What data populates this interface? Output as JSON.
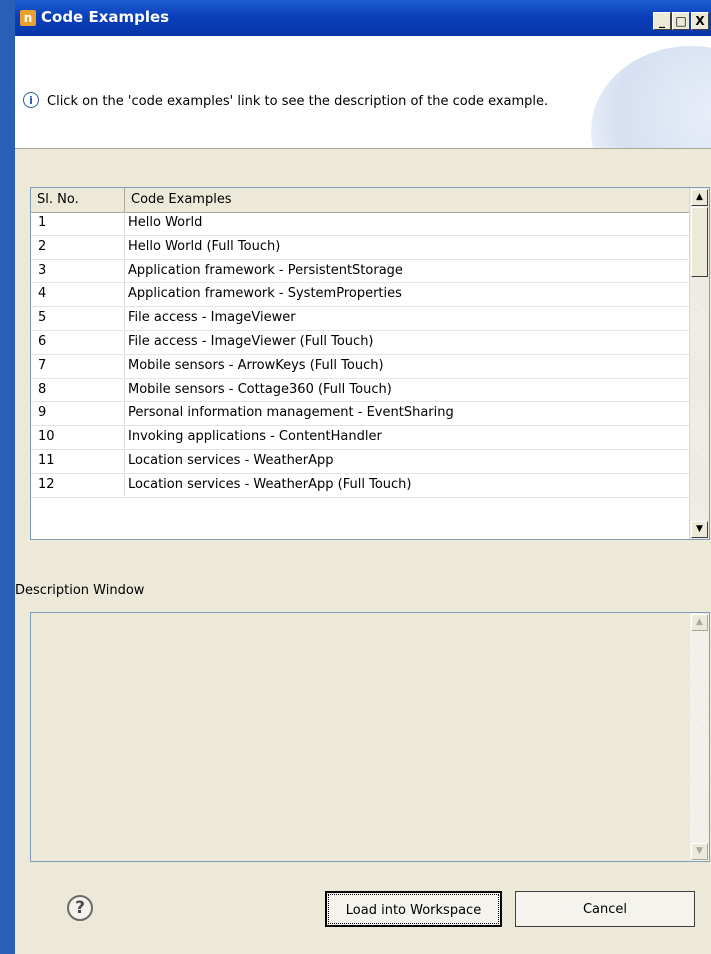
{
  "window": {
    "title": "Code Examples",
    "app_icon_glyph": "n",
    "controls": {
      "minimize": "_",
      "maximize": "□",
      "close": "X"
    }
  },
  "banner": {
    "message": "Click on the 'code examples' link to see the description of the code example.",
    "icon": "info-icon"
  },
  "table": {
    "columns": [
      "Sl. No.",
      "Code Examples"
    ],
    "rows": [
      {
        "no": "1",
        "name": "Hello World"
      },
      {
        "no": "2",
        "name": "Hello World (Full Touch)"
      },
      {
        "no": "3",
        "name": "Application framework - PersistentStorage"
      },
      {
        "no": "4",
        "name": "Application framework - SystemProperties"
      },
      {
        "no": "5",
        "name": "File access - ImageViewer"
      },
      {
        "no": "6",
        "name": "File access - ImageViewer (Full Touch)"
      },
      {
        "no": "7",
        "name": "Mobile sensors - ArrowKeys (Full Touch)"
      },
      {
        "no": "8",
        "name": "Mobile sensors - Cottage360 (Full Touch)"
      },
      {
        "no": "9",
        "name": "Personal information management - EventSharing"
      },
      {
        "no": "10",
        "name": "Invoking applications - ContentHandler"
      },
      {
        "no": "11",
        "name": "Location services - WeatherApp"
      },
      {
        "no": "12",
        "name": "Location services - WeatherApp (Full Touch)"
      }
    ]
  },
  "description": {
    "label": "Description Window",
    "content": ""
  },
  "buttons": {
    "load": "Load into Workspace",
    "cancel": "Cancel",
    "help_glyph": "?"
  },
  "colors": {
    "titlebar": "#0a3fba",
    "dialog_bg": "#ece9d8",
    "desktop": "#2a5fb6"
  }
}
